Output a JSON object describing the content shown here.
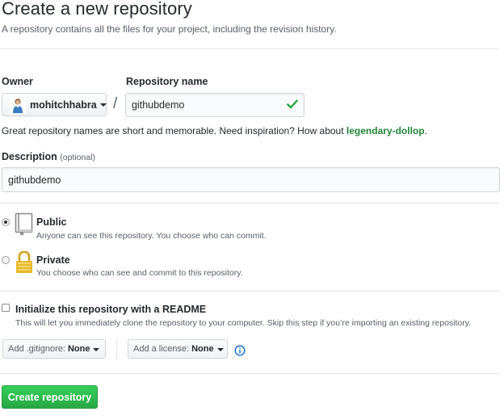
{
  "header": {
    "title": "Create a new repository",
    "subtitle": "A repository contains all the files for your project, including the revision history."
  },
  "owner": {
    "label": "Owner",
    "value": "mohitchhabra",
    "avatar_icon": "user-avatar"
  },
  "separator": "/",
  "repo_name": {
    "label": "Repository name",
    "value": "githubdemo",
    "status_icon": "check-icon",
    "status_color": "#28a745"
  },
  "hint": {
    "text": "Great repository names are short and memorable. Need inspiration? How about ",
    "suggestion": "legendary-dollop",
    "end": "."
  },
  "description": {
    "label": "Description",
    "optional": "(optional)",
    "value": "githubdemo"
  },
  "visibility": {
    "selected": "public",
    "options": [
      {
        "key": "public",
        "title": "Public",
        "desc": "Anyone can see this repository. You choose who can commit.",
        "icon": "repo-book-icon"
      },
      {
        "key": "private",
        "title": "Private",
        "desc": "You choose who can see and commit to this repository.",
        "icon": "lock-icon"
      }
    ]
  },
  "init": {
    "checked": false,
    "title": "Initialize this repository with a README",
    "desc": "This will let you immediately clone the repository to your computer. Skip this step if you’re importing an existing repository."
  },
  "gitignore": {
    "label": "Add .gitignore:",
    "value": "None"
  },
  "license": {
    "label": "Add a license:",
    "value": "None"
  },
  "info_icon": "info-icon",
  "create_button": {
    "label": "Create repository",
    "color": "#28a745"
  }
}
